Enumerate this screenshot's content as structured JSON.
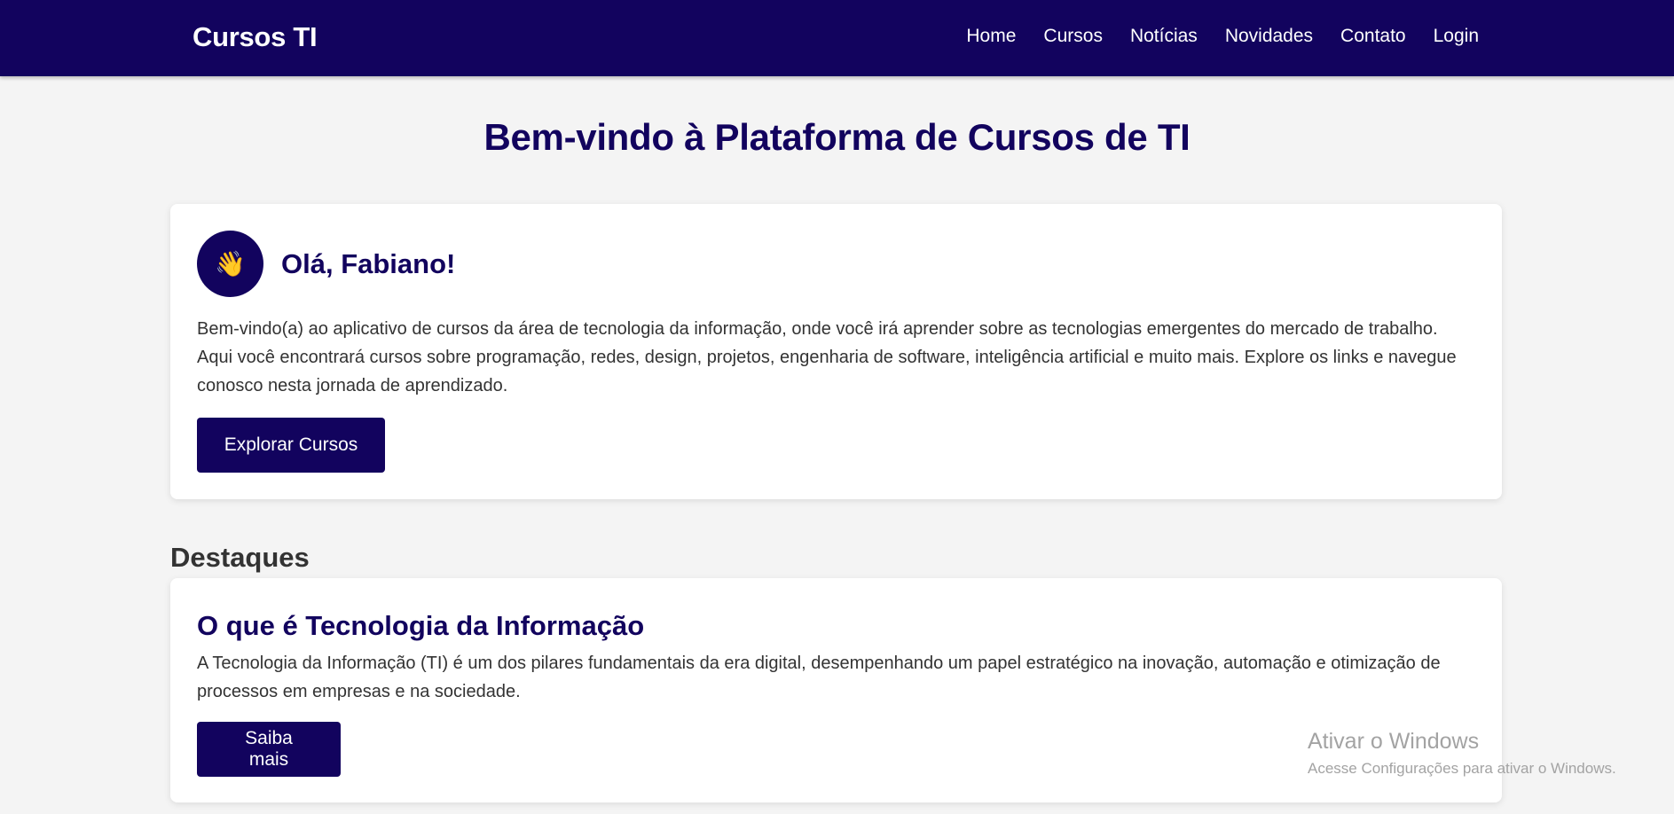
{
  "navbar": {
    "brand": "Cursos TI",
    "links": [
      "Home",
      "Cursos",
      "Notícias",
      "Novidades",
      "Contato",
      "Login"
    ]
  },
  "page_title": "Bem-vindo à Plataforma de Cursos de TI",
  "welcome_card": {
    "avatar_icon": "waving-hand-icon",
    "avatar_glyph": "👋",
    "greeting": "Olá, Fabiano!",
    "text": "Bem-vindo(a) ao aplicativo de cursos da área de tecnologia da informação, onde você irá aprender sobre as tecnologias emergentes do mercado de trabalho. Aqui você encontrará cursos sobre programação, redes, design, projetos, engenharia de software, inteligência artificial e muito mais. Explore os links e navegue conosco nesta jornada de aprendizado.",
    "button": "Explorar Cursos"
  },
  "featured": {
    "heading": "Destaques",
    "title": "O que é Tecnologia da Informação",
    "text": "A Tecnologia da Informação (TI) é um dos pilares fundamentais da era digital, desempenhando um papel estratégico na inovação, automação e otimização de processos em empresas e na sociedade.",
    "button": "Saiba mais"
  },
  "watermark": {
    "title": "Ativar o Windows",
    "subtitle": "Acesse Configurações para ativar o Windows."
  },
  "colors": {
    "primary": "#12035e",
    "background": "#f4f4f4",
    "card": "#ffffff"
  }
}
